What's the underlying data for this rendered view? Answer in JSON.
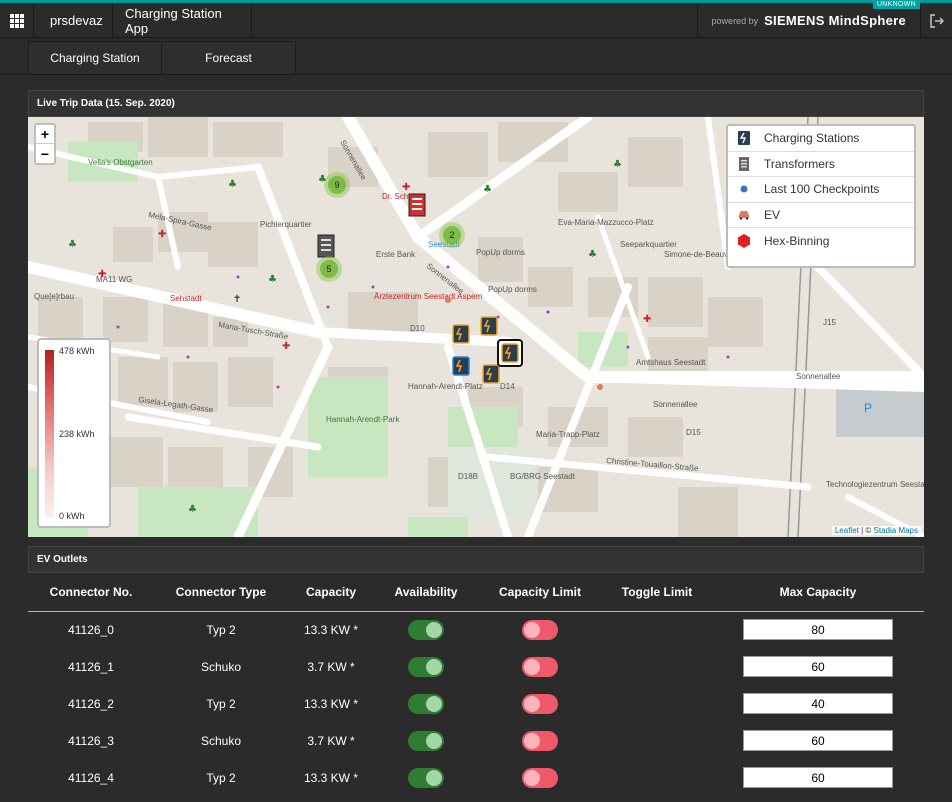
{
  "topbar": {
    "tenant": "prsdevaz",
    "app_title": "Charging Station App",
    "powered_by": "powered by",
    "brand": "SIEMENS MindSphere",
    "env_badge": "UNKNOWN",
    "accent_color": "#009999"
  },
  "tabs": [
    {
      "label": "Charging Station"
    },
    {
      "label": "Forecast"
    }
  ],
  "map_panel": {
    "title": "Live Trip Data (15. Sep. 2020)",
    "zoom_in": "+",
    "zoom_out": "−",
    "legend": [
      {
        "label": "Charging Stations",
        "icon": "charging-station-icon"
      },
      {
        "label": "Transformers",
        "icon": "transformer-icon"
      },
      {
        "label": "Last 100 Checkpoints",
        "icon": "checkpoint-dot-icon"
      },
      {
        "label": "EV",
        "icon": "car-icon"
      },
      {
        "label": "Hex-Binning",
        "icon": "hexagon-icon"
      }
    ],
    "scale": {
      "max": "478 kWh",
      "mid": "238 kWh",
      "min": "0 kWh"
    },
    "attribution_leaflet": "Leaflet",
    "attribution_sep": " | © ",
    "attribution_tiles": "Stadia Maps",
    "clusters": [
      "9",
      "2",
      "5"
    ],
    "labels": {
      "vellas": "Vella's\nObstgarten",
      "mela": "Mela-Spira-Gasse",
      "pichler": "Pichlerquartier",
      "dr_schulte": "Dr. Schulte",
      "erste_bank": "Erste Bank",
      "sonnenallee": "Sonnenallee",
      "maria_tusch": "Maria-Tusch-Straße",
      "hannah_arendt": "Hannah-Arendt-Platz",
      "hannah_park": "Hannah-Arendt-Park",
      "maria_trapp": "Maria-Trapp-Platz",
      "eva_maria": "Eva-Maria-Mazzucco-Platz",
      "seepark": "Seeparkquartier",
      "simone": "Simone-de-Beauvoir-Platz",
      "christine": "Christine-Touaillon-Straße",
      "technologie": "Technologiezentrum Seestadt",
      "arztezentrum": "Ärztezentrum Seestadt Aspern",
      "gisela": "Gisela-Legath-Gasse",
      "sehstadt": "Sehstadt",
      "ma11": "MA11 WG",
      "quejerbau": "Que[e]rbau",
      "d14": "D14",
      "d10": "D10",
      "d18b": "D18B",
      "bg": "BG/BRG Seestadt",
      "j15": "J15",
      "d15": "D15",
      "popup": "PopUp dorms",
      "seestadt": "Seestadt",
      "amtshaus": "Amtshaus Seestadt"
    }
  },
  "outlets": {
    "title": "EV Outlets",
    "columns": [
      "Connector No.",
      "Connector Type",
      "Capacity",
      "Availability",
      "Capacity Limit",
      "Toggle Limit",
      "Max Capacity"
    ],
    "rows": [
      {
        "connector": "41126_0",
        "type": "Typ 2",
        "capacity": "13.3 KW *",
        "available": true,
        "limit": false,
        "max": "80"
      },
      {
        "connector": "41126_1",
        "type": "Schuko",
        "capacity": "3.7 KW *",
        "available": true,
        "limit": false,
        "max": "60"
      },
      {
        "connector": "41126_2",
        "type": "Typ 2",
        "capacity": "13.3 KW *",
        "available": true,
        "limit": false,
        "max": "40"
      },
      {
        "connector": "41126_3",
        "type": "Schuko",
        "capacity": "3.7 KW *",
        "available": true,
        "limit": false,
        "max": "60"
      },
      {
        "connector": "41126_4",
        "type": "Typ 2",
        "capacity": "13.3 KW *",
        "available": true,
        "limit": false,
        "max": "60"
      }
    ]
  }
}
